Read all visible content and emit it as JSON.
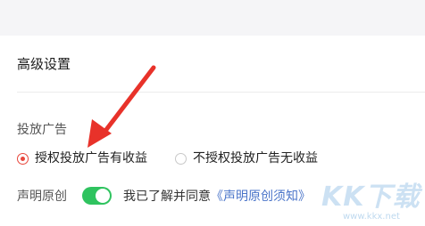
{
  "section": {
    "title": "高级设置"
  },
  "ads": {
    "label": "投放广告",
    "options": [
      {
        "label": "授权投放广告有收益",
        "selected": true
      },
      {
        "label": "不授权投放广告无收益",
        "selected": false
      }
    ]
  },
  "declaration": {
    "label": "声明原创",
    "toggle_on": true,
    "agree_text": "我已了解并同意",
    "link_text": "《声明原创须知》"
  },
  "watermark": {
    "logo": "KK下载",
    "url": "www.kkx.net"
  },
  "colors": {
    "accent_red": "#e8473c",
    "toggle_green": "#2fc35f",
    "link_blue": "#4a74c9"
  }
}
